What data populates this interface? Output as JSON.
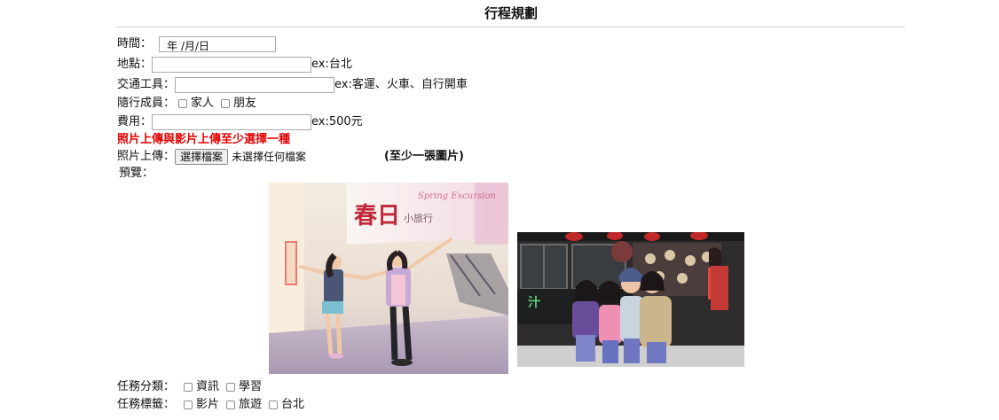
{
  "title": "行程規劃",
  "form": {
    "date_label": "時間：",
    "date_value": "年 /月/日",
    "location_label": "地點：",
    "location_hint": "ex:台北",
    "transport_label": "交通工具：",
    "transport_hint": "ex:客運、火車、自行開車",
    "companions_label": "隨行成員：",
    "companions": [
      "家人",
      "朋友"
    ],
    "cost_label": "費用：",
    "cost_hint": "ex:500元",
    "upload_warning": "照片上傳與影片上傳至少選擇一種",
    "photo_label": "照片上傳：",
    "file_button": "選擇檔案",
    "no_file_text": "未選擇任何檔案",
    "photo_note": "(至少一張圖片)",
    "preview_label": "預覽：",
    "category_label": "任務分類：",
    "categories": [
      "資訊",
      "學習"
    ],
    "tags_label": "任務標籤：",
    "tags": [
      "影片",
      "旅遊",
      "台北"
    ]
  },
  "preview": {
    "photo1": {
      "banner_big": "春日",
      "banner_small": "小旅行",
      "banner_en": "Spring Excursion"
    },
    "photo2": {}
  }
}
